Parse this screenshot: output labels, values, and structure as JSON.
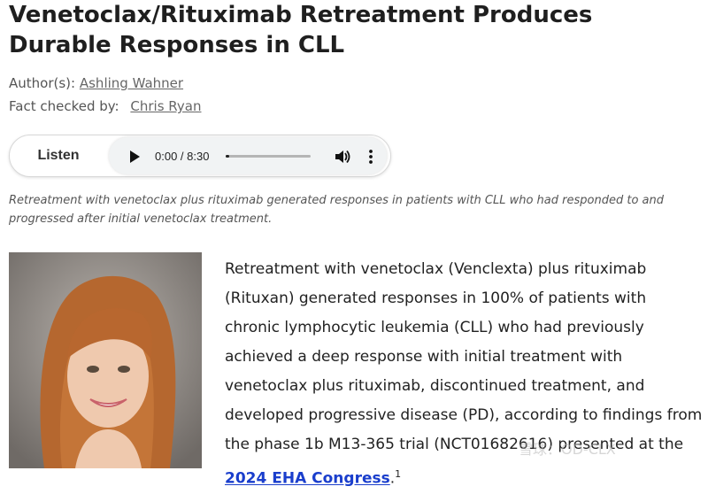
{
  "article": {
    "title": "Venetoclax/Rituximab Retreatment Produces Durable Responses in CLL",
    "authors_label": "Author(s):",
    "author_name": "Ashling Wahner",
    "fact_checked_label": "Fact checked by:",
    "fact_checker_name": "Chris Ryan"
  },
  "audio": {
    "listen_label": "Listen",
    "time_display": "0:00 / 8:30",
    "progress": 0.0,
    "icons": [
      "play-icon",
      "volume-icon",
      "more-options-icon"
    ]
  },
  "summary": "Retreatment with venetoclax plus rituximab generated responses in patients with CLL who had responded to and progressed after initial venetoclax treatment.",
  "body": {
    "paragraph_start": "Retreatment with venetoclax (Venclexta) plus rituximab (Rituxan) generated responses in 100% of patients with chronic lymphocytic leukemia (CLL) who had previously achieved a deep response with initial treatment with venetoclax plus rituximab, discontinued treatment, and developed progressive disease (PD), according to findings from the phase 1b M13-365 trial (NCT01682616) presented at the ",
    "link_text": "2024 EHA Congress",
    "after_link": ".",
    "footnote": "1"
  },
  "photo": {
    "subject": "author-headshot"
  },
  "watermark": {
    "text": "雪球：OD-CLX"
  }
}
